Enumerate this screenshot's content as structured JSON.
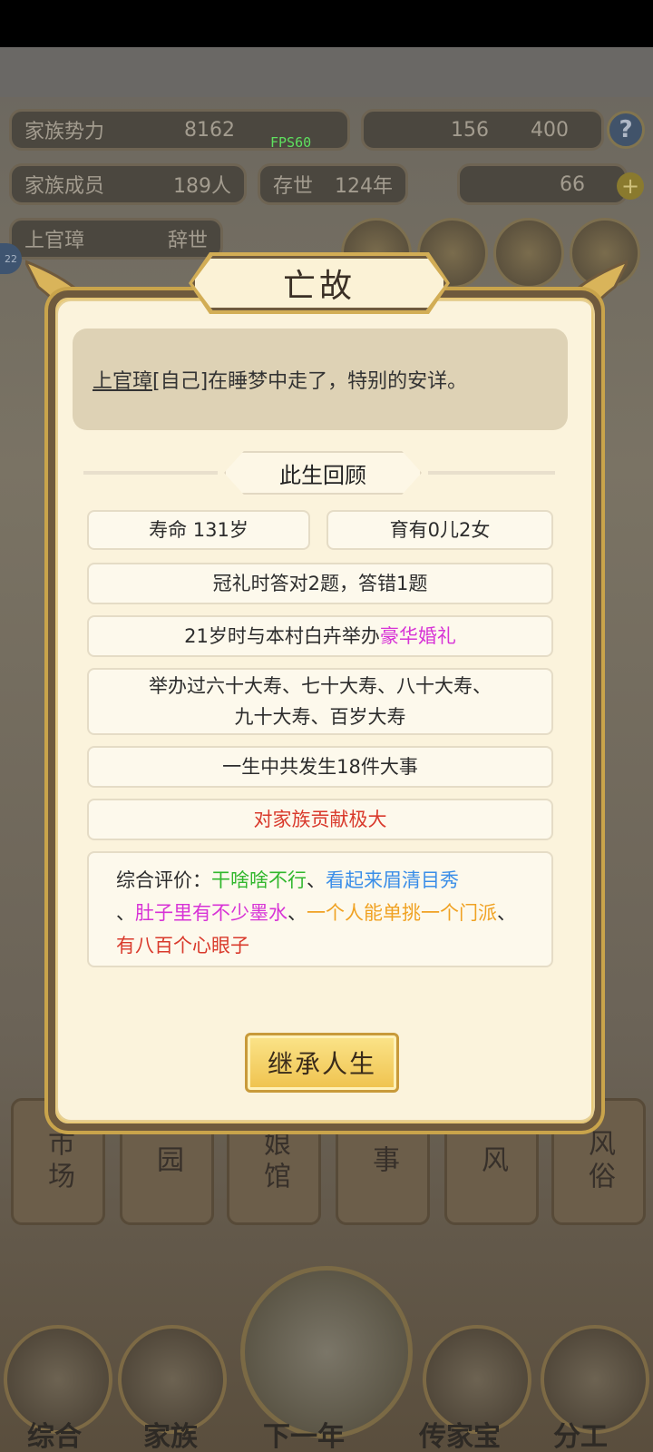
{
  "background": {
    "stats": {
      "family_power_label": "家族势力",
      "family_power_value": "8162",
      "fps": "FPS60",
      "resource_value": "156",
      "resource_value2": "400",
      "members_label": "家族成员",
      "members_value": "189人",
      "existence_label": "存世",
      "existence_value": "124年",
      "gold_value": "66",
      "person_name": "上官璋",
      "person_status": "辞世",
      "level": "22"
    },
    "tiles": [
      "市场",
      "园",
      "娘馆",
      "事",
      "风",
      "风俗"
    ],
    "nav": [
      "综合",
      "家族",
      "下一年",
      "传家宝",
      "分工"
    ]
  },
  "dialog": {
    "title": "亡故",
    "message": {
      "name": "上官璋",
      "text": "[自己]在睡梦中走了，特别的安详。"
    },
    "section_title": "此生回顾",
    "lifespan": "寿命 131岁",
    "children": "育有0儿2女",
    "capping": "冠礼时答对2题，答错1题",
    "wedding_prefix": "21岁时与本村白卉举办",
    "wedding_highlight": "豪华婚礼",
    "birthdays_line1": "举办过六十大寿、七十大寿、八十大寿、",
    "birthdays_line2": "九十大寿、百岁大寿",
    "events": "一生中共发生18件大事",
    "contribution": "对家族贡献极大",
    "evaluation": {
      "label": "综合评价：",
      "t1": "干啥啥不行",
      "sep1": "、",
      "t2": "看起来眉清目秀",
      "sep2": "、",
      "t3": "肚子里有不少墨水",
      "sep3": "、",
      "t4": "一个人能单挑一个门派",
      "sep4": "、",
      "t5": "有八百个心眼子"
    },
    "inherit_button": "继承人生"
  },
  "colors": {
    "highlight_magenta": "#d733d6",
    "highlight_red": "#d93a2c",
    "highlight_green": "#31b72d",
    "highlight_blue": "#3a8ee8",
    "highlight_orange": "#f0a223"
  }
}
